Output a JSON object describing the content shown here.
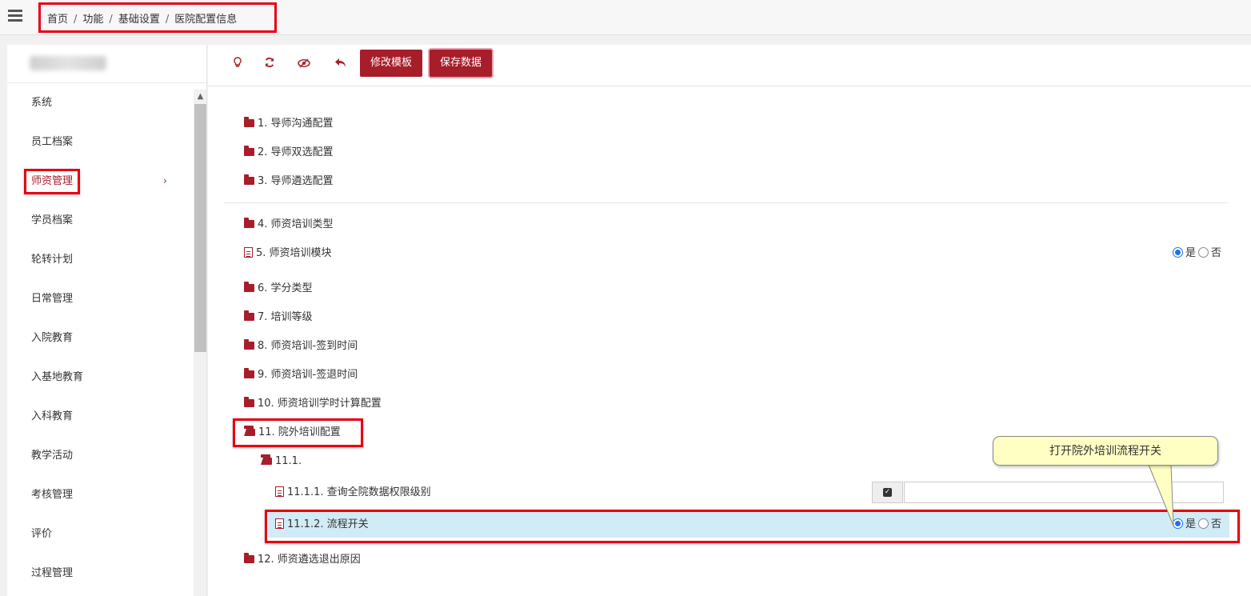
{
  "topbar": {
    "menu_icon": "hamburger-icon",
    "breadcrumb": [
      "首页",
      "功能",
      "基础设置",
      "医院配置信息"
    ],
    "separator": "/"
  },
  "sidebar": {
    "items": [
      {
        "label": "系统"
      },
      {
        "label": "员工档案"
      },
      {
        "label": "师资管理",
        "active": true,
        "chevron": "›"
      },
      {
        "label": "学员档案"
      },
      {
        "label": "轮转计划"
      },
      {
        "label": "日常管理"
      },
      {
        "label": "入院教育"
      },
      {
        "label": "入基地教育"
      },
      {
        "label": "入科教育"
      },
      {
        "label": "教学活动"
      },
      {
        "label": "考核管理"
      },
      {
        "label": "评价"
      },
      {
        "label": "过程管理"
      }
    ],
    "scroll_up_arrow": "▲"
  },
  "toolbar": {
    "icons": [
      "lightbulb-icon",
      "refresh-icon",
      "eye-slash-icon",
      "undo-icon"
    ],
    "glyphs": [
      "💡",
      "⟳",
      "◎",
      "↶"
    ],
    "edit_template_label": "修改模板",
    "save_data_label": "保存数据"
  },
  "tree": {
    "nodes": [
      {
        "label": "1. 导师沟通配置",
        "type": "folder"
      },
      {
        "label": "2. 导师双选配置",
        "type": "folder"
      },
      {
        "label": "3. 导师遴选配置",
        "type": "folder"
      },
      {
        "label": "4. 师资培训类型",
        "type": "folder"
      },
      {
        "label": "5. 师资培训模块",
        "type": "doc"
      },
      {
        "label": "6. 学分类型",
        "type": "folder"
      },
      {
        "label": "7. 培训等级",
        "type": "folder"
      },
      {
        "label": "8. 师资培训-签到时间",
        "type": "folder"
      },
      {
        "label": "9. 师资培训-签退时间",
        "type": "folder"
      },
      {
        "label": "10. 师资培训学时计算配置",
        "type": "folder"
      },
      {
        "label": "11. 院外培训配置",
        "type": "folder-open"
      },
      {
        "label": "11.1.",
        "type": "folder-open"
      },
      {
        "label": "11.1.1. 查询全院数据权限级别",
        "type": "doc"
      },
      {
        "label": "11.1.2. 流程开关",
        "type": "doc"
      },
      {
        "label": "12. 师资遴选退出原因",
        "type": "folder"
      }
    ],
    "radio_yes": "是",
    "radio_no": "否",
    "checkbox_mark": "✓",
    "input_value": ""
  },
  "callout": {
    "text": "打开院外培训流程开关"
  },
  "colors": {
    "accent": "#a71d2a",
    "highlight_border": "#e60012",
    "selected_row": "#d1ebf7",
    "callout_bg": "#ffffc4",
    "radio_checked": "#1a73e8"
  }
}
